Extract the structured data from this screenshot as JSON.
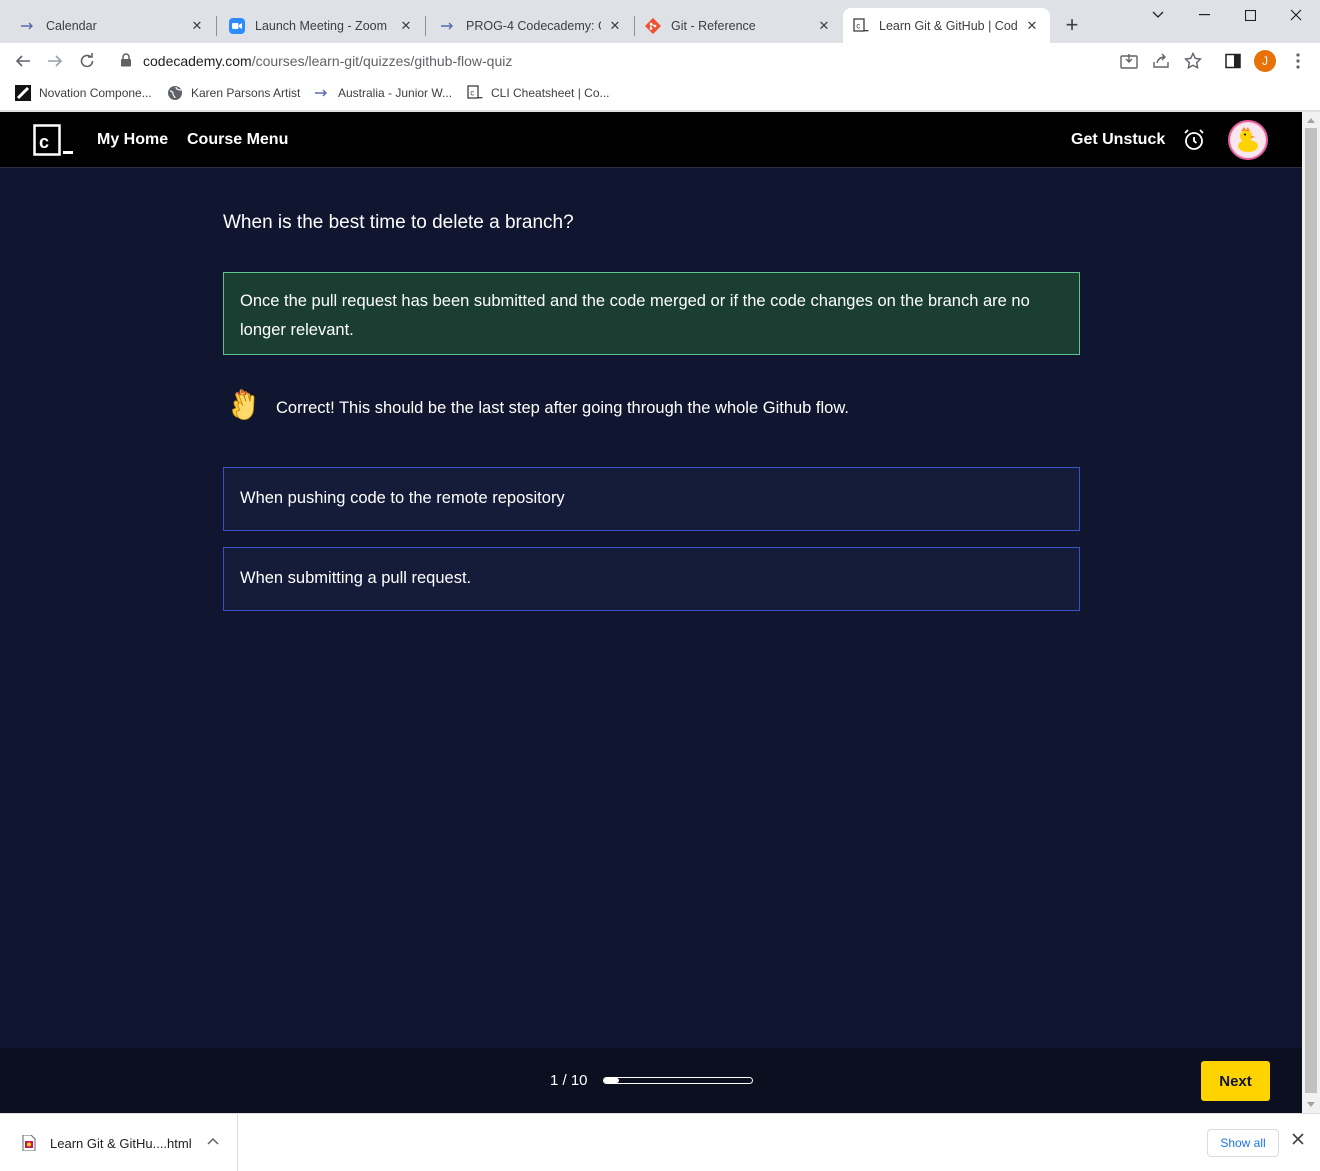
{
  "browser": {
    "tabs": [
      {
        "title": "Calendar",
        "icon": "arrow-favicon"
      },
      {
        "title": "Launch Meeting - Zoom",
        "icon": "zoom-favicon"
      },
      {
        "title": "PROG-4 Codecademy: Git",
        "icon": "arrow-favicon"
      },
      {
        "title": "Git - Reference",
        "icon": "git-favicon"
      },
      {
        "title": "Learn Git & GitHub | Codec",
        "icon": "codecademy-favicon"
      }
    ],
    "url_host": "codecademy.com",
    "url_path": "/courses/learn-git/quizzes/github-flow-quiz",
    "profile_initial": "J",
    "bookmarks": [
      {
        "label": "Novation Compone...",
        "icon": "novation-favicon"
      },
      {
        "label": "Karen Parsons Artist",
        "icon": "globe-favicon"
      },
      {
        "label": "Australia - Junior W...",
        "icon": "arrow-favicon"
      },
      {
        "label": "CLI Cheatsheet | Co...",
        "icon": "codecademy-favicon"
      }
    ]
  },
  "header": {
    "my_home": "My Home",
    "course_menu": "Course Menu",
    "get_unstuck": "Get Unstuck"
  },
  "quiz": {
    "question": "When is the best time to delete a branch?",
    "correct_answer": "Once the pull request has been submitted and the code merged or if the code changes on the branch are no longer relevant.",
    "feedback": "Correct! This should be the last step after going through the whole Github flow.",
    "options": [
      "When pushing code to the remote repository",
      "When submitting a pull request."
    ]
  },
  "footer": {
    "progress_label": "1 / 10",
    "progress_fraction": 0.1,
    "next_label": "Next"
  },
  "downloads": {
    "file_name": "Learn Git & GitHu....html",
    "show_all": "Show all"
  },
  "colors": {
    "page_bg": "#10162f",
    "correct_bg": "#1a3e32",
    "correct_border": "#58c48e",
    "option_border": "#3a50c8",
    "next_button": "#ffd300"
  }
}
